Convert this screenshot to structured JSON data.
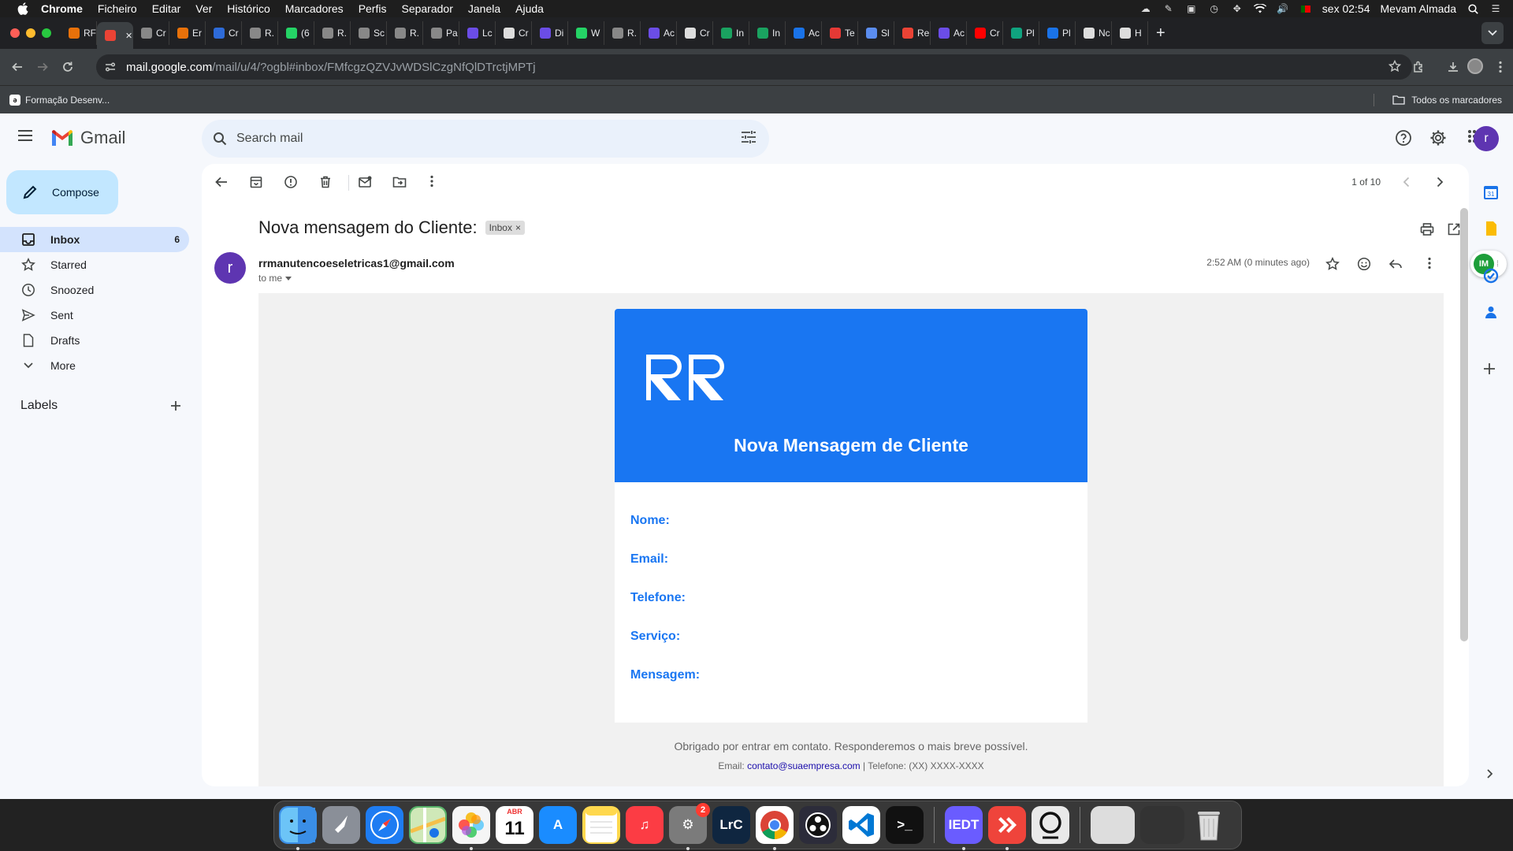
{
  "macos": {
    "menu": [
      "Chrome",
      "Ficheiro",
      "Editar",
      "Ver",
      "Histórico",
      "Marcadores",
      "Perfis",
      "Separador",
      "Janela",
      "Ajuda"
    ],
    "clock": "sex 02:54",
    "user": "Mevam Almada"
  },
  "chrome": {
    "tabs": [
      {
        "label": "RF",
        "color": "#e8710a",
        "icon": "figma-like-icon"
      },
      {
        "label": "",
        "color": "#ea4335",
        "icon": "gmail-icon",
        "active": true
      },
      {
        "label": "Cr",
        "color": "#888",
        "icon": "globe-icon"
      },
      {
        "label": "Er",
        "color": "#e8710a",
        "icon": "gitlab-icon"
      },
      {
        "label": "Cr",
        "color": "#2e6bd8",
        "icon": "app-icon"
      },
      {
        "label": "R.",
        "color": "#888",
        "icon": "globe-icon"
      },
      {
        "label": "(6",
        "color": "#25d366",
        "icon": "whatsapp-icon"
      },
      {
        "label": "R.",
        "color": "#888",
        "icon": "globe-icon"
      },
      {
        "label": "Sc",
        "color": "#888",
        "icon": "globe-icon"
      },
      {
        "label": "R.",
        "color": "#888",
        "icon": "globe-icon"
      },
      {
        "label": "Pa",
        "color": "#888",
        "icon": "globe-icon"
      },
      {
        "label": "Lc",
        "color": "#6b4de6",
        "icon": "m-icon"
      },
      {
        "label": "Cr",
        "color": "#ddd",
        "icon": "openai-icon"
      },
      {
        "label": "Di",
        "color": "#6b4de6",
        "icon": "m-icon"
      },
      {
        "label": "W",
        "color": "#25d366",
        "icon": "whatsapp-icon"
      },
      {
        "label": "R.",
        "color": "#888",
        "icon": "globe-icon"
      },
      {
        "label": "Ac",
        "color": "#6b4de6",
        "icon": "m-icon"
      },
      {
        "label": "Cr",
        "color": "#ddd",
        "icon": "app-icon"
      },
      {
        "label": "In",
        "color": "#1aa260",
        "icon": "app-icon"
      },
      {
        "label": "In",
        "color": "#1aa260",
        "icon": "app-icon"
      },
      {
        "label": "Ac",
        "color": "#1a73e8",
        "icon": "app-icon"
      },
      {
        "label": "Te",
        "color": "#e53935",
        "icon": "lock-icon"
      },
      {
        "label": "Sl",
        "color": "#5b8def",
        "icon": "shield-icon"
      },
      {
        "label": "Re",
        "color": "#ea4335",
        "icon": "gmail-icon"
      },
      {
        "label": "Ac",
        "color": "#6b4de6",
        "icon": "m-icon"
      },
      {
        "label": "Cr",
        "color": "#ff0000",
        "icon": "youtube-icon"
      },
      {
        "label": "Pl",
        "color": "#10a37f",
        "icon": "app-icon"
      },
      {
        "label": "Pl",
        "color": "#1a73e8",
        "icon": "app-icon"
      },
      {
        "label": "Nc",
        "color": "#ddd",
        "icon": "github-icon"
      },
      {
        "label": "H",
        "color": "#ddd",
        "icon": "download-icon"
      }
    ],
    "url_host": "mail.google.com",
    "url_path": "/mail/u/4/?ogbl#inbox/FMfcgzQZVJvWDSlCzgNfQlDTrctjMPTj",
    "bookmark": "Formação Desenv...",
    "all_bookmarks": "Todos os marcadores"
  },
  "gmail": {
    "brand": "Gmail",
    "search_placeholder": "Search mail",
    "compose": "Compose",
    "avatar_letter": "r",
    "nav": [
      {
        "label": "Inbox",
        "count": "6",
        "icon": "inbox-icon",
        "active": true
      },
      {
        "label": "Starred",
        "count": "",
        "icon": "star-icon"
      },
      {
        "label": "Snoozed",
        "count": "",
        "icon": "clock-icon"
      },
      {
        "label": "Sent",
        "count": "",
        "icon": "send-icon"
      },
      {
        "label": "Drafts",
        "count": "",
        "icon": "draft-icon"
      },
      {
        "label": "More",
        "count": "",
        "icon": "chevron-down-icon"
      }
    ],
    "labels_title": "Labels",
    "pager": "1 of 10",
    "subject": "Nova mensagem do Cliente:",
    "chip": "Inbox",
    "sender": "rrmanutencoeseletricas1@gmail.com",
    "to": "to me",
    "time": "2:52 AM (0 minutes ago)",
    "sender_letter": "r"
  },
  "email": {
    "logo_text": "RR",
    "title": "Nova Mensagem de Cliente",
    "fields": [
      "Nome:",
      "Email:",
      "Telefone:",
      "Serviço:",
      "Mensagem:"
    ],
    "footer_msg": "Obrigado por entrar em contato. Responderemos o mais breve possível.",
    "footer_email_label": "Email: ",
    "footer_email": "contato@suaempresa.com",
    "footer_phone": " | Telefone: (XX) XXXX-XXXX",
    "accent": "#1976f2"
  },
  "dock": [
    {
      "name": "finder",
      "label": "",
      "color": "#3a8ee6"
    },
    {
      "name": "launchpad",
      "label": "",
      "color": "#8a8f98"
    },
    {
      "name": "safari",
      "label": "",
      "color": "#1e7cf2"
    },
    {
      "name": "maps",
      "label": "",
      "color": "#59b36a"
    },
    {
      "name": "photos",
      "label": "",
      "color": "#f5f5f5"
    },
    {
      "name": "calendar",
      "label": "11",
      "color": "#ffffff",
      "sub": "ABR"
    },
    {
      "name": "app-store",
      "label": "A",
      "color": "#1a8cff"
    },
    {
      "name": "notes",
      "label": "",
      "color": "#ffd84d"
    },
    {
      "name": "music",
      "label": "♫",
      "color": "#fc3c44"
    },
    {
      "name": "system-settings",
      "label": "⚙",
      "color": "#7b7b7b",
      "badge": "2"
    },
    {
      "name": "lightroom",
      "label": "LrC",
      "color": "#0f2640"
    },
    {
      "name": "chrome",
      "label": "",
      "color": "#ffffff"
    },
    {
      "name": "obs",
      "label": "",
      "color": "#2c2c3a"
    },
    {
      "name": "vscode",
      "label": "",
      "color": "#ffffff"
    },
    {
      "name": "terminal",
      "label": ">_",
      "color": "#111"
    },
    {
      "name": "iedt",
      "label": "IEDT",
      "color": "#6a5cff"
    },
    {
      "name": "anydesk",
      "label": "",
      "color": "#ef443b"
    },
    {
      "name": "zoom-webcam",
      "label": "",
      "color": "#e9e9e9"
    }
  ]
}
